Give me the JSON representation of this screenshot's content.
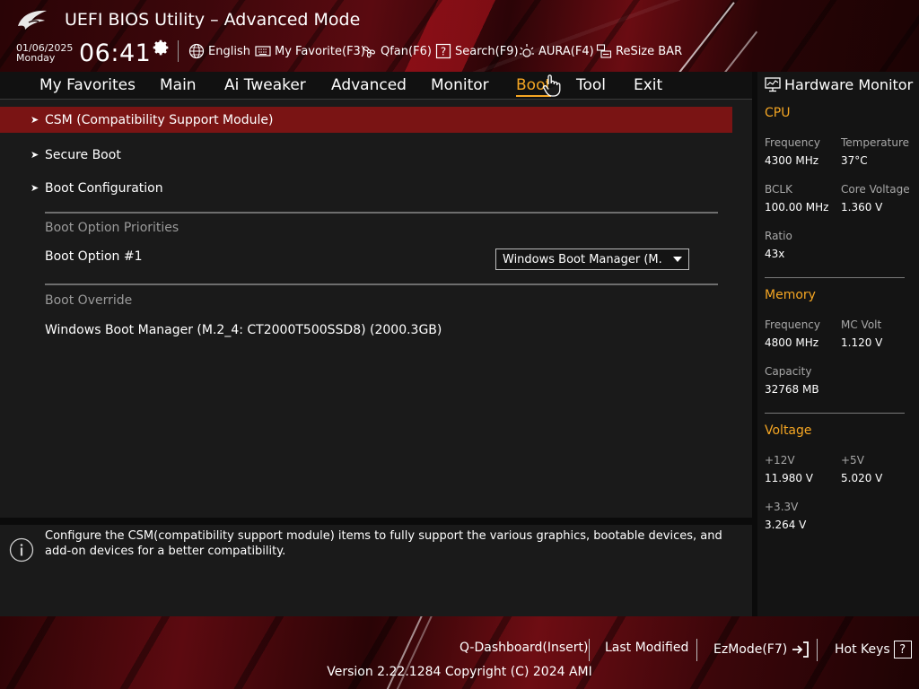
{
  "header": {
    "title": "UEFI BIOS Utility – Advanced Mode",
    "date": "01/06/2025",
    "weekday": "Monday",
    "time": "06:41",
    "items": [
      {
        "label": "English",
        "icon": "globe-icon"
      },
      {
        "label": "My Favorite(F3)",
        "icon": "keyboard-icon"
      },
      {
        "label": "Qfan(F6)",
        "icon": "fan-icon"
      },
      {
        "label": "Search(F9)",
        "icon": "question-box-icon"
      },
      {
        "label": "AURA(F4)",
        "icon": "aura-light-icon"
      },
      {
        "label": "ReSize BAR",
        "icon": "resize-bar-icon"
      }
    ]
  },
  "tabs": [
    {
      "label": "My Favorites"
    },
    {
      "label": "Main"
    },
    {
      "label": "Ai Tweaker"
    },
    {
      "label": "Advanced"
    },
    {
      "label": "Monitor"
    },
    {
      "label": "Boot",
      "active": true
    },
    {
      "label": "Tool"
    },
    {
      "label": "Exit"
    }
  ],
  "menu": {
    "items": [
      {
        "label": "CSM (Compatibility Support Module)",
        "selected": true
      },
      {
        "label": "Secure Boot"
      },
      {
        "label": "Boot Configuration"
      }
    ],
    "boot_option_priorities_label": "Boot Option Priorities",
    "boot_option_1_label": "Boot Option #1",
    "boot_option_1_value": "Windows Boot Manager (M.",
    "boot_override_label": "Boot Override",
    "boot_override_item": "Windows Boot Manager (M.2_4: CT2000T500SSD8) (2000.3GB)"
  },
  "help": {
    "text": "Configure the CSM(compatibility support module) items to fully support the various graphics, bootable devices, and add-on devices for a better compatibility."
  },
  "hw_monitor": {
    "title": "Hardware Monitor",
    "cpu": {
      "title": "CPU",
      "frequency_label": "Frequency",
      "frequency_value": "4300 MHz",
      "temperature_label": "Temperature",
      "temperature_value": "37°C",
      "bclk_label": "BCLK",
      "bclk_value": "100.00 MHz",
      "core_voltage_label": "Core Voltage",
      "core_voltage_value": "1.360 V",
      "ratio_label": "Ratio",
      "ratio_value": "43x"
    },
    "memory": {
      "title": "Memory",
      "frequency_label": "Frequency",
      "frequency_value": "4800 MHz",
      "mc_volt_label": "MC Volt",
      "mc_volt_value": "1.120 V",
      "capacity_label": "Capacity",
      "capacity_value": "32768 MB"
    },
    "voltage": {
      "title": "Voltage",
      "v12_label": "+12V",
      "v12_value": "11.980 V",
      "v5_label": "+5V",
      "v5_value": "5.020 V",
      "v33_label": "+3.3V",
      "v33_value": "3.264 V"
    }
  },
  "footer": {
    "q_dashboard": "Q-Dashboard(Insert)",
    "last_modified": "Last Modified",
    "ezmode": "EzMode(F7)",
    "hot_keys": "Hot Keys",
    "hot_keys_symbol": "?",
    "version": "Version 2.22.1284 Copyright (C) 2024 AMI"
  },
  "colors": {
    "accent": "#f5a623",
    "selected_row": "#7a1414",
    "panel": "#1a1a1a"
  }
}
